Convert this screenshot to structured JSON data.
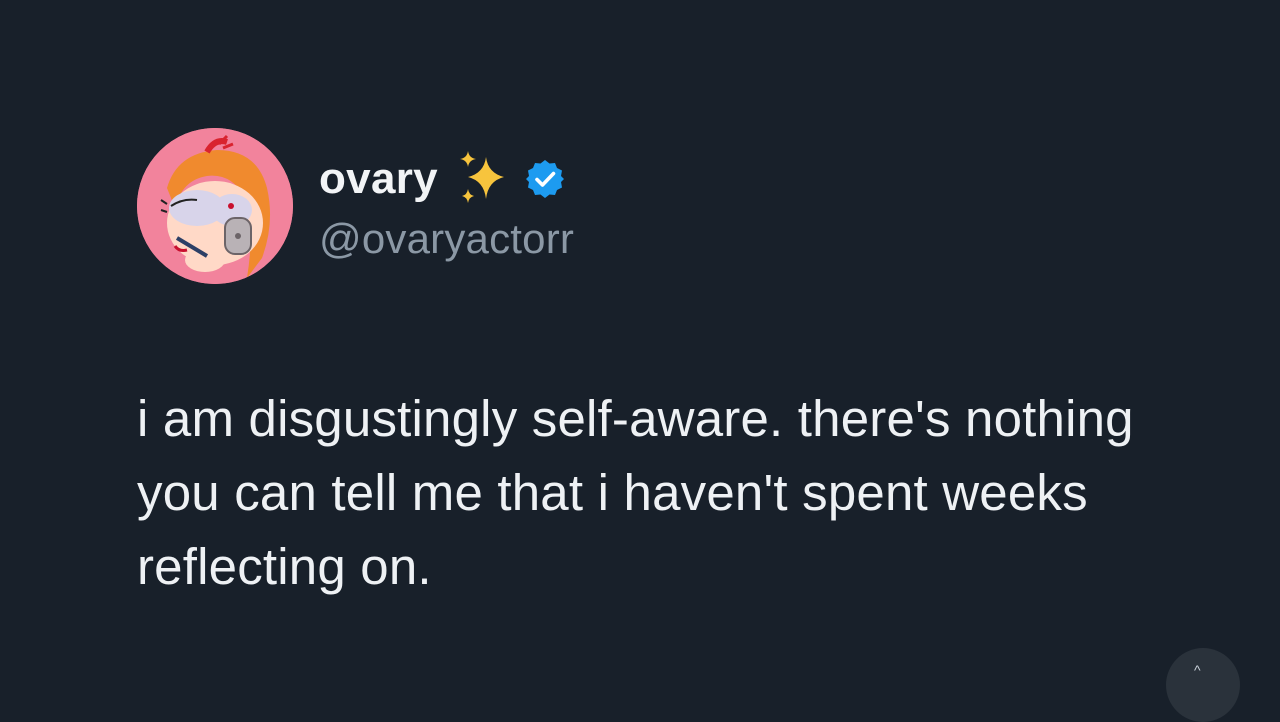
{
  "profile": {
    "display_name": "ovary",
    "handle": "@ovaryactorr",
    "name_emoji": "sparkles-icon",
    "verified_icon": "verified-badge-icon"
  },
  "tweet": {
    "text": "i am disgustingly self-aware. there's nothing you can tell me that i haven't spent weeks reflecting on."
  },
  "colors": {
    "background": "#18202a",
    "primary_text": "#eef1f4",
    "secondary_text": "#8b98a5",
    "verified_blue": "#1d9bf0",
    "sparkle_yellow": "#f7c43d",
    "avatar_bg": "#f2839c"
  }
}
